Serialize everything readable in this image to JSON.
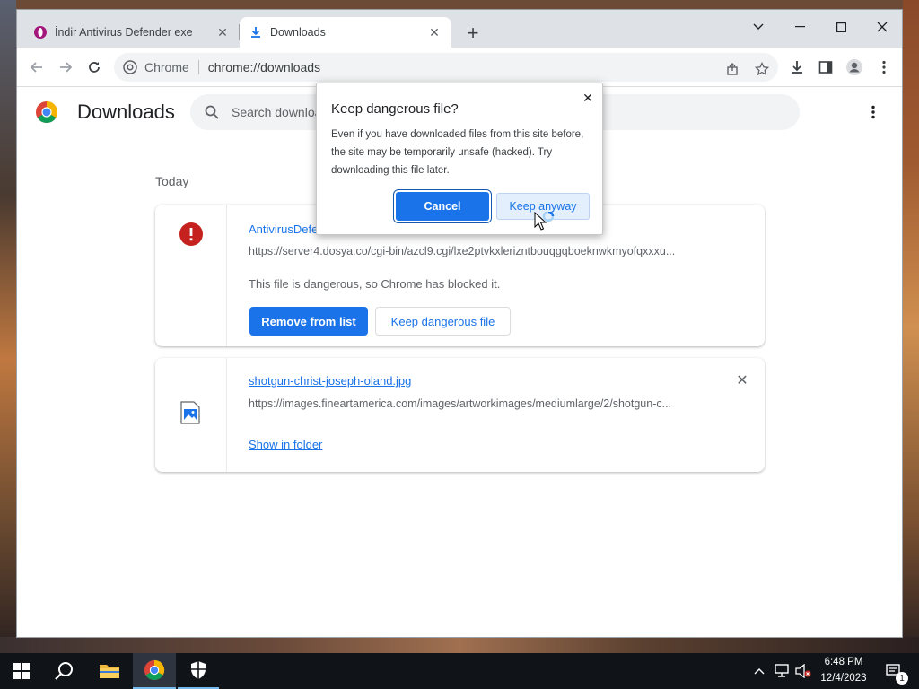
{
  "tabs": [
    {
      "title": "İndir Antivirus Defender exe",
      "icon": "opera-icon"
    },
    {
      "title": "Downloads",
      "icon": "download-icon"
    }
  ],
  "omnibox": {
    "site_name": "Chrome",
    "url": "chrome://downloads"
  },
  "page": {
    "title": "Downloads",
    "search_placeholder": "Search downloads",
    "section": "Today"
  },
  "downloads": [
    {
      "file_name": "AntivirusDefender",
      "url": "https://server4.dosya.co/cgi-bin/azcl9.cgi/lxe2ptvkxlerizntbouqgqboeknwkmyofqxxxu...",
      "status": "This file is dangerous, so Chrome has blocked it.",
      "remove_label": "Remove from list",
      "keep_label": "Keep dangerous file",
      "icon": "error-icon"
    },
    {
      "file_name": "shotgun-christ-joseph-oland.jpg",
      "url": "https://images.fineartamerica.com/images/artworkimages/mediumlarge/2/shotgun-c...",
      "show_label": "Show in folder",
      "icon": "image-file-icon"
    }
  ],
  "dialog": {
    "title": "Keep dangerous file?",
    "body": "Even if you have downloaded files from this site before, the site may be temporarily unsafe (hacked). Try downloading this file later.",
    "cancel_label": "Cancel",
    "keep_label": "Keep anyway"
  },
  "taskbar": {
    "time": "6:48 PM",
    "date": "12/4/2023",
    "notification_count": "1"
  },
  "colors": {
    "accent": "#1a73e8",
    "danger": "#c5221f"
  }
}
